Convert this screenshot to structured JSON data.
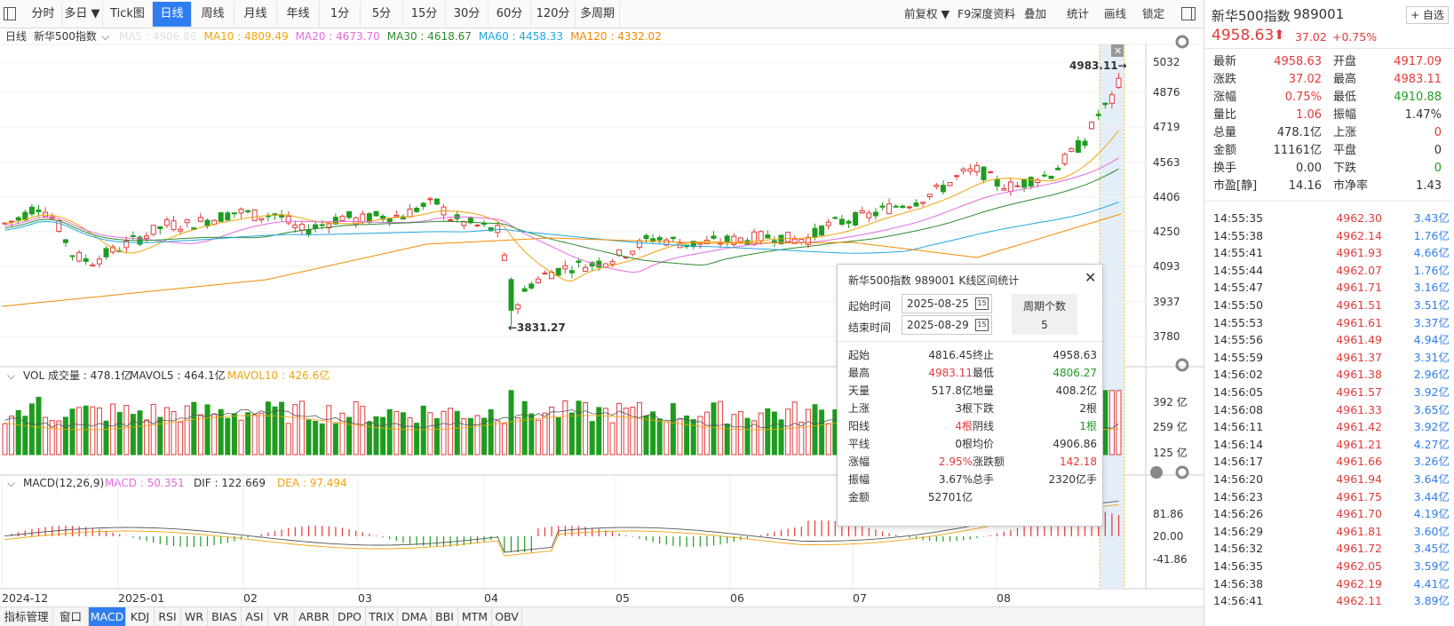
{
  "toolbar": {
    "period_tabs": [
      "分时",
      "多日 ▼",
      "Tick图",
      "日线",
      "周线",
      "月线",
      "年线",
      "1分",
      "5分",
      "15分",
      "30分",
      "60分",
      "120分",
      "多周期"
    ],
    "active_tab": "日线",
    "right_tools": [
      "前复权 ▼",
      "F9深度资料",
      "叠加",
      "统计",
      "画线",
      "锁定"
    ]
  },
  "main_chart": {
    "period": "日线",
    "name": "新华500指数",
    "ma_labels": [
      {
        "text": "MA5 : 4906.86",
        "color": "#e0e0e0"
      },
      {
        "text": "MA10 : 4809.49",
        "color": "#f0a30a"
      },
      {
        "text": "MA20 : 4673.70",
        "color": "#e46ae0"
      },
      {
        "text": "MA30 : 4618.67",
        "color": "#2e8b2e"
      },
      {
        "text": "MA60 : 4458.33",
        "color": "#21a6e0"
      },
      {
        "text": "MA120 : 4332.02",
        "color": "#f08a00"
      }
    ],
    "y_ticks": [
      "5032",
      "4876",
      "4719",
      "4563",
      "4406",
      "4250",
      "4093",
      "3937",
      "3780"
    ],
    "high_marker": "4983.11→",
    "low_marker": "←3831.27"
  },
  "volume": {
    "title": "VOL 成交量 : 478.1亿",
    "mavol5": "MAVOL5 : 464.1亿",
    "mavol10": "MAVOL10 : 426.6亿",
    "y_ticks": [
      "392 亿",
      "259 亿",
      "125 亿"
    ]
  },
  "macd": {
    "title": "MACD(12,26,9)",
    "macd_val": "MACD : 50.351",
    "dif": "DIF : 122.669",
    "dea": "DEA : 97.494",
    "y_ticks": [
      "81.86",
      "20.00",
      "-41.86"
    ]
  },
  "x_axis": [
    "2024-12",
    "2025-01",
    "02",
    "03",
    "04",
    "05",
    "06",
    "07",
    "08"
  ],
  "bottom_tabs": [
    "指标管理",
    "窗口",
    "MACD",
    "KDJ",
    "RSI",
    "WR",
    "BIAS",
    "ASI",
    "VR",
    "ARBR",
    "DPO",
    "TRIX",
    "DMA",
    "BBI",
    "MTM",
    "OBV"
  ],
  "active_bottom_tab": "MACD",
  "popup": {
    "title": "新华500指数 989001 K线区间统计",
    "start_label": "起始时间",
    "start_date": "2025-08-25",
    "end_label": "结束时间",
    "end_date": "2025-08-29",
    "period_count_label": "周期个数",
    "period_count": "5",
    "stats_left": [
      {
        "label": "起始",
        "value": "4816.45",
        "color": "#333"
      },
      {
        "label": "最高",
        "value": "4983.11",
        "color": "#e23a3a"
      },
      {
        "label": "天量",
        "value": "517.8亿",
        "color": "#333"
      },
      {
        "label": "上涨",
        "value": "3根",
        "color": "#333"
      },
      {
        "label": "阳线",
        "value": "4根",
        "color": "#e23a3a"
      },
      {
        "label": "平线",
        "value": "0根",
        "color": "#333"
      },
      {
        "label": "涨幅",
        "value": "2.95%",
        "color": "#e23a3a"
      },
      {
        "label": "振幅",
        "value": "3.67%",
        "color": "#333"
      },
      {
        "label": "金额",
        "value": "52701亿",
        "color": "#333"
      }
    ],
    "stats_right": [
      {
        "label": "终止",
        "value": "4958.63",
        "color": "#333"
      },
      {
        "label": "最低",
        "value": "4806.27",
        "color": "#1f9c1f"
      },
      {
        "label": "地量",
        "value": "408.2亿",
        "color": "#333"
      },
      {
        "label": "下跌",
        "value": "2根",
        "color": "#333"
      },
      {
        "label": "阴线",
        "value": "1根",
        "color": "#1f9c1f"
      },
      {
        "label": "均价",
        "value": "4906.86",
        "color": "#333"
      },
      {
        "label": "涨跌额",
        "value": "142.18",
        "color": "#e23a3a"
      },
      {
        "label": "总手",
        "value": "2320亿手",
        "color": "#333"
      }
    ]
  },
  "quote": {
    "name": "新华500指数",
    "code": "989001",
    "add_button": "+ 自选",
    "price": "4958.63",
    "change": "37.02",
    "pct": "+0.75%",
    "rows": [
      {
        "l1": "最新",
        "v1": "4958.63",
        "c1": "#e23a3a",
        "l2": "开盘",
        "v2": "4917.09",
        "c2": "#e23a3a"
      },
      {
        "l1": "涨跌",
        "v1": "37.02",
        "c1": "#e23a3a",
        "l2": "最高",
        "v2": "4983.11",
        "c2": "#e23a3a"
      },
      {
        "l1": "涨幅",
        "v1": "0.75%",
        "c1": "#e23a3a",
        "l2": "最低",
        "v2": "4910.88",
        "c2": "#1f9c1f"
      },
      {
        "l1": "量比",
        "v1": "1.06",
        "c1": "#e23a3a",
        "l2": "振幅",
        "v2": "1.47%",
        "c2": "#333"
      },
      {
        "l1": "总量",
        "v1": "478.1亿",
        "c1": "#333",
        "l2": "上涨",
        "v2": "0",
        "c2": "#e23a3a"
      },
      {
        "l1": "金额",
        "v1": "11161亿",
        "c1": "#333",
        "l2": "平盘",
        "v2": "0",
        "c2": "#333"
      },
      {
        "l1": "换手",
        "v1": "0.00",
        "c1": "#333",
        "l2": "下跌",
        "v2": "0",
        "c2": "#1f9c1f"
      },
      {
        "l1": "市盈[静]",
        "v1": "14.16",
        "c1": "#333",
        "l2": "市净率",
        "v2": "1.43",
        "c2": "#333"
      }
    ]
  },
  "ticks": [
    {
      "time": "14:55:35",
      "price": "4962.30",
      "vol": "3.43亿"
    },
    {
      "time": "14:55:38",
      "price": "4962.14",
      "vol": "1.76亿"
    },
    {
      "time": "14:55:41",
      "price": "4961.93",
      "vol": "4.66亿"
    },
    {
      "time": "14:55:44",
      "price": "4962.07",
      "vol": "1.76亿"
    },
    {
      "time": "14:55:47",
      "price": "4961.71",
      "vol": "3.16亿"
    },
    {
      "time": "14:55:50",
      "price": "4961.51",
      "vol": "3.51亿"
    },
    {
      "time": "14:55:53",
      "price": "4961.61",
      "vol": "3.37亿"
    },
    {
      "time": "14:55:56",
      "price": "4961.49",
      "vol": "4.94亿"
    },
    {
      "time": "14:55:59",
      "price": "4961.37",
      "vol": "3.31亿"
    },
    {
      "time": "14:56:02",
      "price": "4961.38",
      "vol": "2.96亿"
    },
    {
      "time": "14:56:05",
      "price": "4961.57",
      "vol": "3.92亿"
    },
    {
      "time": "14:56:08",
      "price": "4961.33",
      "vol": "3.65亿"
    },
    {
      "time": "14:56:11",
      "price": "4961.42",
      "vol": "3.92亿"
    },
    {
      "time": "14:56:14",
      "price": "4961.21",
      "vol": "4.27亿"
    },
    {
      "time": "14:56:17",
      "price": "4961.66",
      "vol": "3.26亿"
    },
    {
      "time": "14:56:20",
      "price": "4961.94",
      "vol": "3.64亿"
    },
    {
      "time": "14:56:23",
      "price": "4961.75",
      "vol": "3.44亿"
    },
    {
      "time": "14:56:26",
      "price": "4961.70",
      "vol": "4.19亿"
    },
    {
      "time": "14:56:29",
      "price": "4961.81",
      "vol": "3.60亿"
    },
    {
      "time": "14:56:32",
      "price": "4961.72",
      "vol": "3.45亿"
    },
    {
      "time": "14:56:35",
      "price": "4962.05",
      "vol": "3.59亿"
    },
    {
      "time": "14:56:38",
      "price": "4962.19",
      "vol": "4.41亿"
    },
    {
      "time": "14:56:41",
      "price": "4962.11",
      "vol": "3.89亿"
    }
  ],
  "colors": {
    "up": "#e23a3a",
    "down": "#1f9c1f",
    "accent": "#2f7ef0",
    "vol": "#2f7ef0"
  }
}
